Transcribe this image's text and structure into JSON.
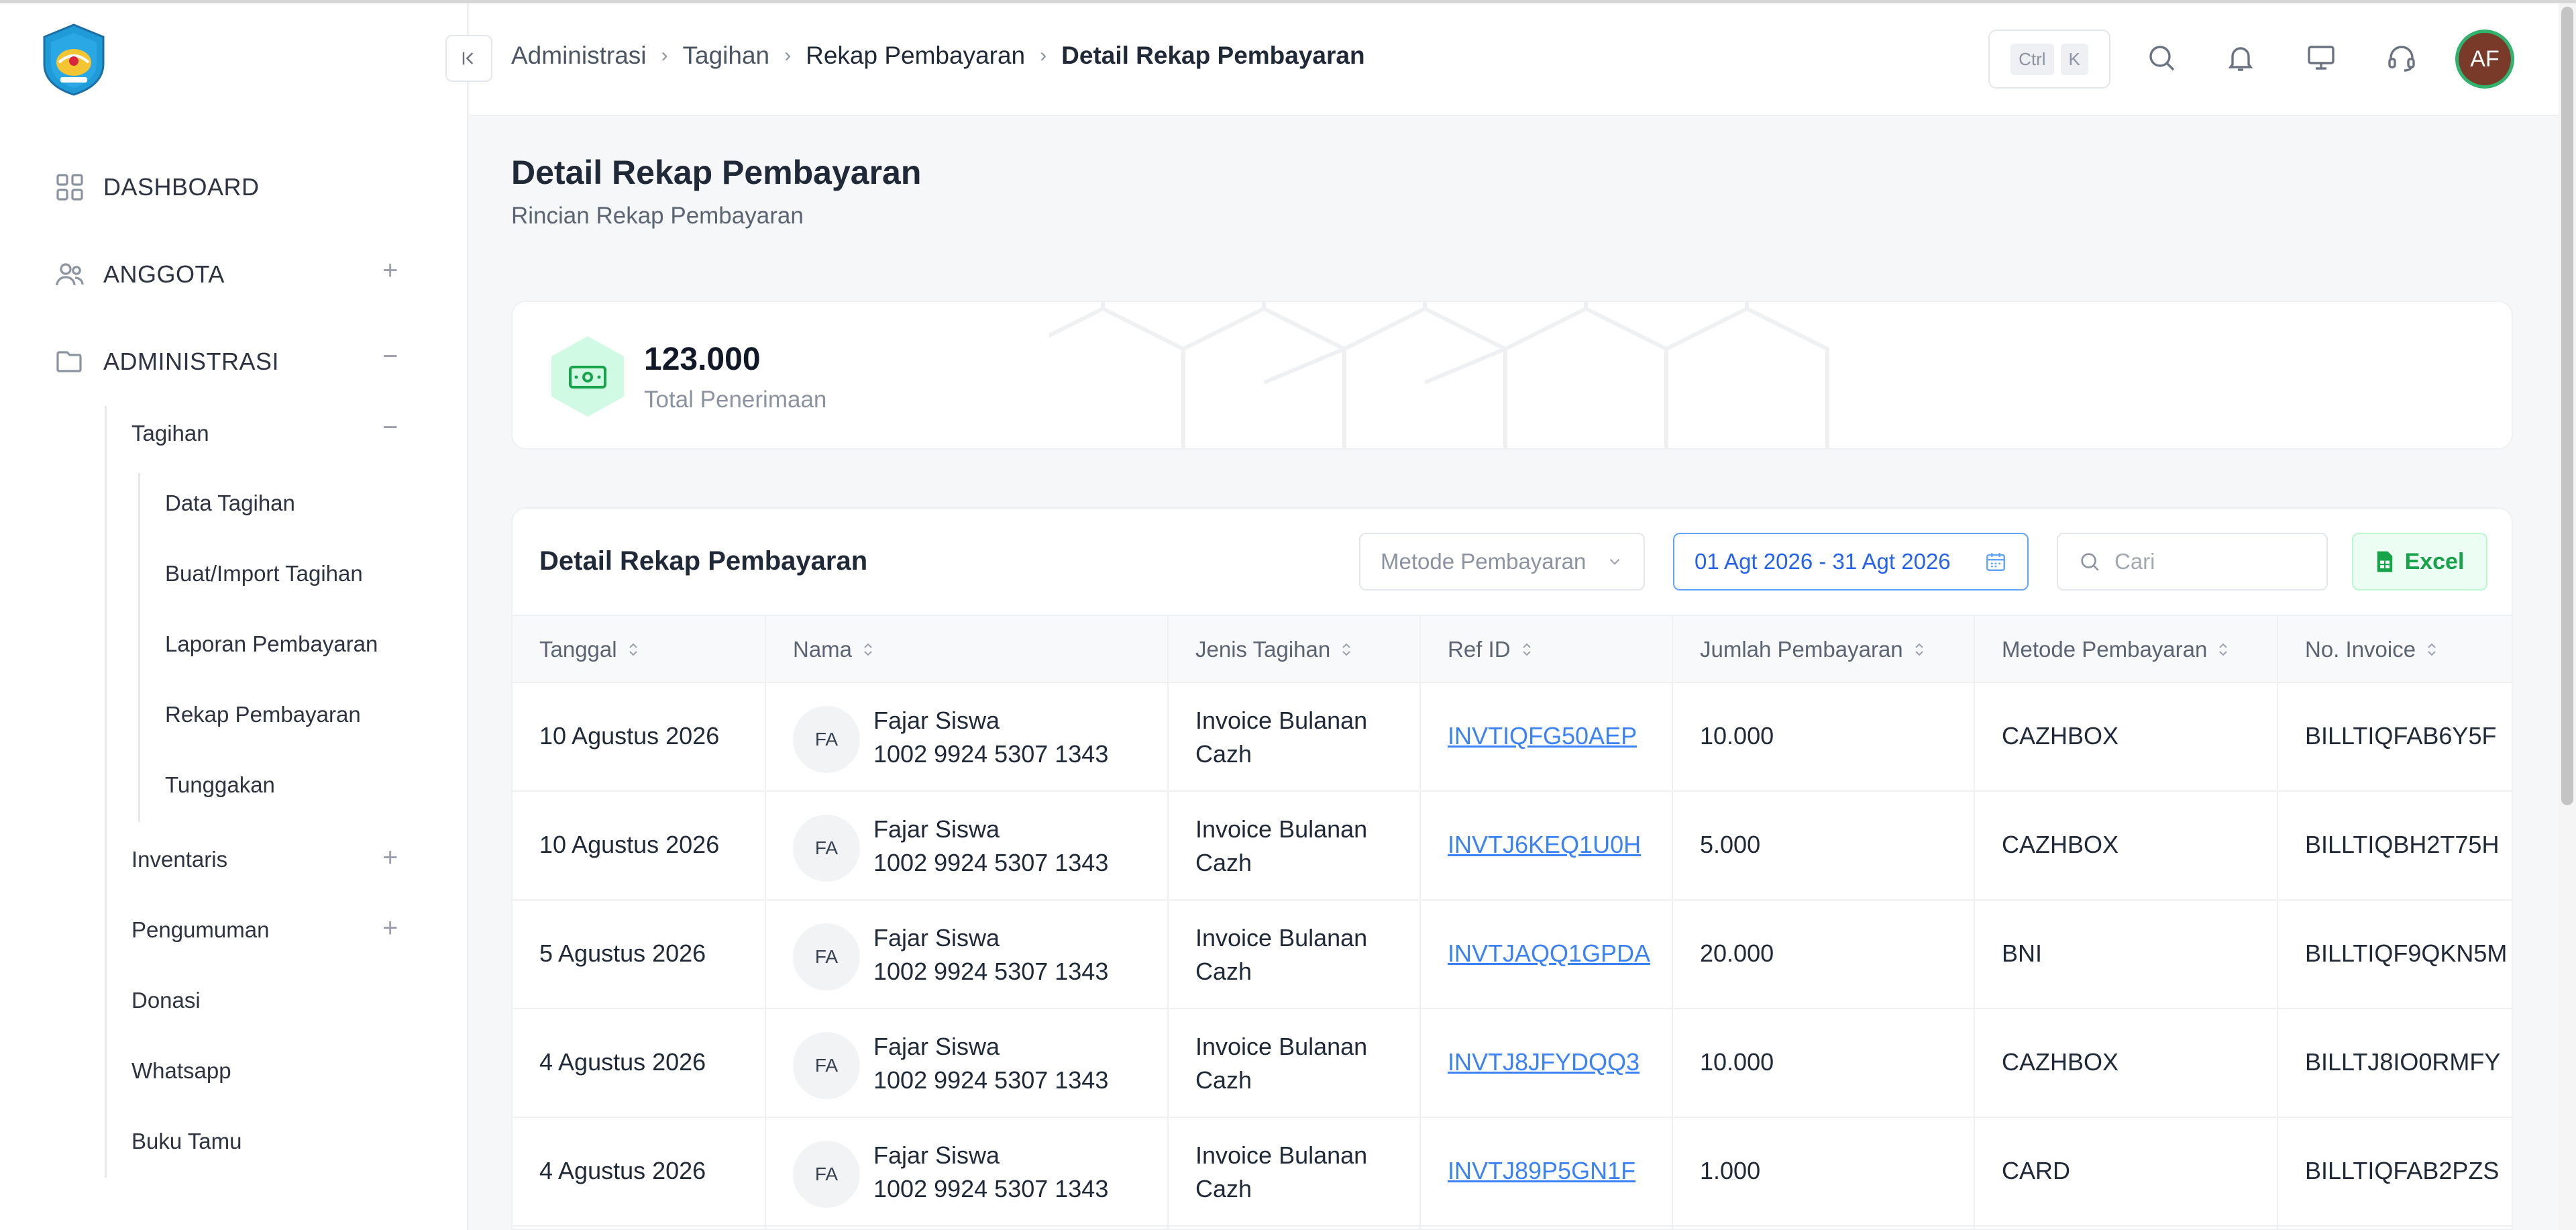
{
  "app": {
    "logo": "tut-wuri-handayani-logo"
  },
  "sidebar": {
    "main": [
      {
        "label": "DASHBOARD",
        "icon": "grid-icon"
      },
      {
        "label": "ANGGOTA",
        "icon": "users-icon"
      },
      {
        "label": "ADMINISTRASI",
        "icon": "folder-icon"
      }
    ],
    "admin_items": [
      {
        "label": "Tagihan",
        "expanded": true
      },
      {
        "label": "Inventaris",
        "expanded": false
      },
      {
        "label": "Pengumuman",
        "expanded": false
      },
      {
        "label": "Donasi"
      },
      {
        "label": "Whatsapp"
      },
      {
        "label": "Buku Tamu"
      }
    ],
    "tagihan_items": [
      "Data Tagihan",
      "Buat/Import Tagihan",
      "Laporan Pembayaran",
      "Rekap Pembayaran",
      "Tunggakan"
    ]
  },
  "header": {
    "breadcrumb": [
      "Administrasi",
      "Tagihan",
      "Rekap Pembayaran",
      "Detail Rekap Pembayaran"
    ],
    "shortcut": {
      "mod": "Ctrl",
      "key": "K"
    },
    "avatar_initials": "AF"
  },
  "page": {
    "title": "Detail Rekap Pembayaran",
    "subtitle": "Rincian Rekap Pembayaran"
  },
  "summary": {
    "value": "123.000",
    "label": "Total Penerimaan"
  },
  "table": {
    "title": "Detail Rekap Pembayaran",
    "filter_method_placeholder": "Metode Pembayaran",
    "date_range": "01 Agt 2026 - 31 Agt 2026",
    "search_placeholder": "Cari",
    "export_label": "Excel",
    "columns": [
      "Tanggal",
      "Nama",
      "Jenis Tagihan",
      "Ref ID",
      "Jumlah Pembayaran",
      "Metode Pembayaran",
      "No. Invoice"
    ],
    "rows": [
      {
        "tanggal": "10 Agustus 2026",
        "initials": "FA",
        "nama": "Fajar Siswa",
        "nomor": "1002 9924 5307 1343",
        "jenis1": "Invoice Bulanan",
        "jenis2": "Cazh",
        "ref": "INVTIQFG50AEP",
        "jumlah": "10.000",
        "metode": "CAZHBOX",
        "invoice": "BILLTIQFAB6Y5F"
      },
      {
        "tanggal": "10 Agustus 2026",
        "initials": "FA",
        "nama": "Fajar Siswa",
        "nomor": "1002 9924 5307 1343",
        "jenis1": "Invoice Bulanan",
        "jenis2": "Cazh",
        "ref": "INVTJ6KEQ1U0H",
        "jumlah": "5.000",
        "metode": "CAZHBOX",
        "invoice": "BILLTIQBH2T75H"
      },
      {
        "tanggal": "5 Agustus 2026",
        "initials": "FA",
        "nama": "Fajar Siswa",
        "nomor": "1002 9924 5307 1343",
        "jenis1": "Invoice Bulanan",
        "jenis2": "Cazh",
        "ref": "INVTJAQQ1GPDA",
        "jumlah": "20.000",
        "metode": "BNI",
        "invoice": "BILLTIQF9QKN5M"
      },
      {
        "tanggal": "4 Agustus 2026",
        "initials": "FA",
        "nama": "Fajar Siswa",
        "nomor": "1002 9924 5307 1343",
        "jenis1": "Invoice Bulanan",
        "jenis2": "Cazh",
        "ref": "INVTJ8JFYDQQ3",
        "jumlah": "10.000",
        "metode": "CAZHBOX",
        "invoice": "BILLTJ8IO0RMFY"
      },
      {
        "tanggal": "4 Agustus 2026",
        "initials": "FA",
        "nama": "Fajar Siswa",
        "nomor": "1002 9924 5307 1343",
        "jenis1": "Invoice Bulanan",
        "jenis2": "Cazh",
        "ref": "INVTJ89P5GN1F",
        "jumlah": "1.000",
        "metode": "CARD",
        "invoice": "BILLTIQFAB2PZS"
      }
    ]
  },
  "colors": {
    "accent_blue": "#2563eb",
    "success_green": "#16a34a",
    "avatar_bg": "#7a3a2a"
  }
}
